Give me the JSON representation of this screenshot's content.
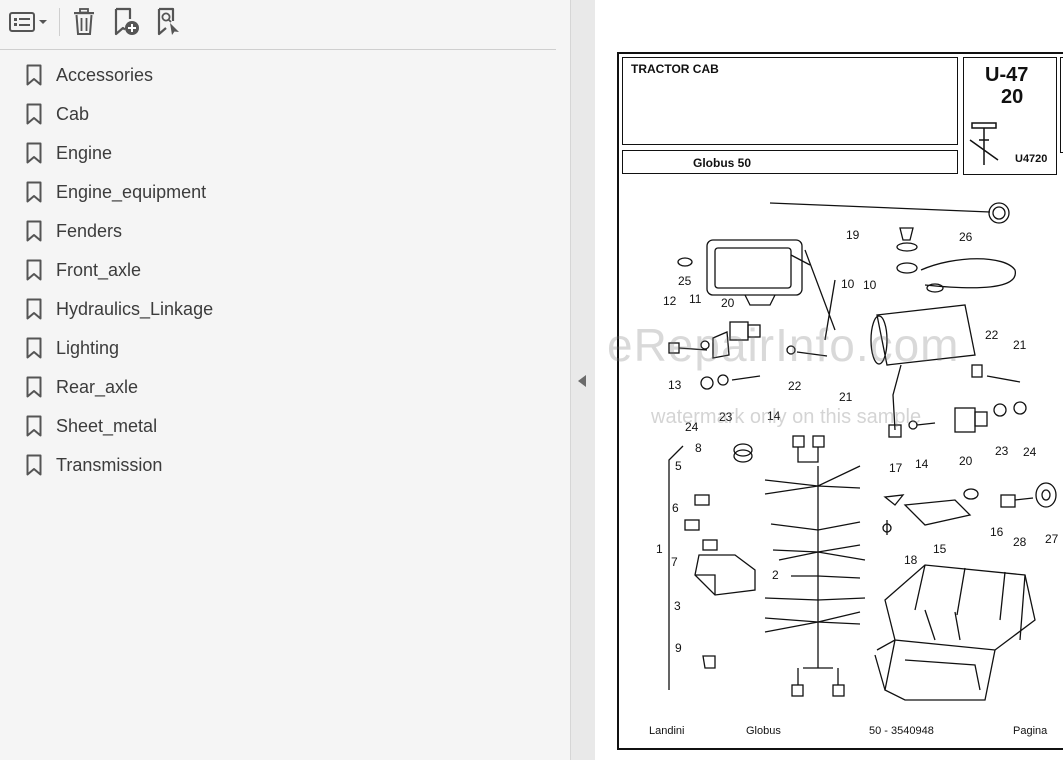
{
  "toolbar": {
    "options_icon": "list-options-icon",
    "delete_icon": "trash-icon",
    "new_bookmark_icon": "bookmark-add-icon",
    "search_bookmark_icon": "bookmark-search-icon"
  },
  "bookmarks": [
    {
      "label": "Accessories"
    },
    {
      "label": "Cab"
    },
    {
      "label": "Engine"
    },
    {
      "label": "Engine_equipment"
    },
    {
      "label": "Fenders"
    },
    {
      "label": "Front_axle"
    },
    {
      "label": "Hydraulics_Linkage"
    },
    {
      "label": "Lighting"
    },
    {
      "label": "Rear_axle"
    },
    {
      "label": "Sheet_metal"
    },
    {
      "label": "Transmission"
    }
  ],
  "page": {
    "title": "TRACTOR CAB",
    "model": "Globus 50",
    "code_line1": "U-47",
    "code_line2": "20",
    "ref": "U4720",
    "callouts": [
      "26",
      "19",
      "25",
      "10",
      "10",
      "12",
      "11",
      "20",
      "22",
      "21",
      "13",
      "22",
      "21",
      "24",
      "23",
      "14",
      "23",
      "24",
      "8",
      "14",
      "20",
      "5",
      "17",
      "6",
      "16",
      "28",
      "27",
      "1",
      "7",
      "15",
      "18",
      "2",
      "3",
      "9"
    ],
    "footer": {
      "brand": "Landini",
      "series": "Globus",
      "part": "50 - 3540948",
      "page_label": "Pagina"
    },
    "watermark_main": "eRepairInfo.com",
    "watermark_sub": "watermark only on this sample"
  },
  "colors": {
    "sidebar_bg": "#f5f5f5",
    "text": "#3c3c3c",
    "icon": "#555555"
  }
}
